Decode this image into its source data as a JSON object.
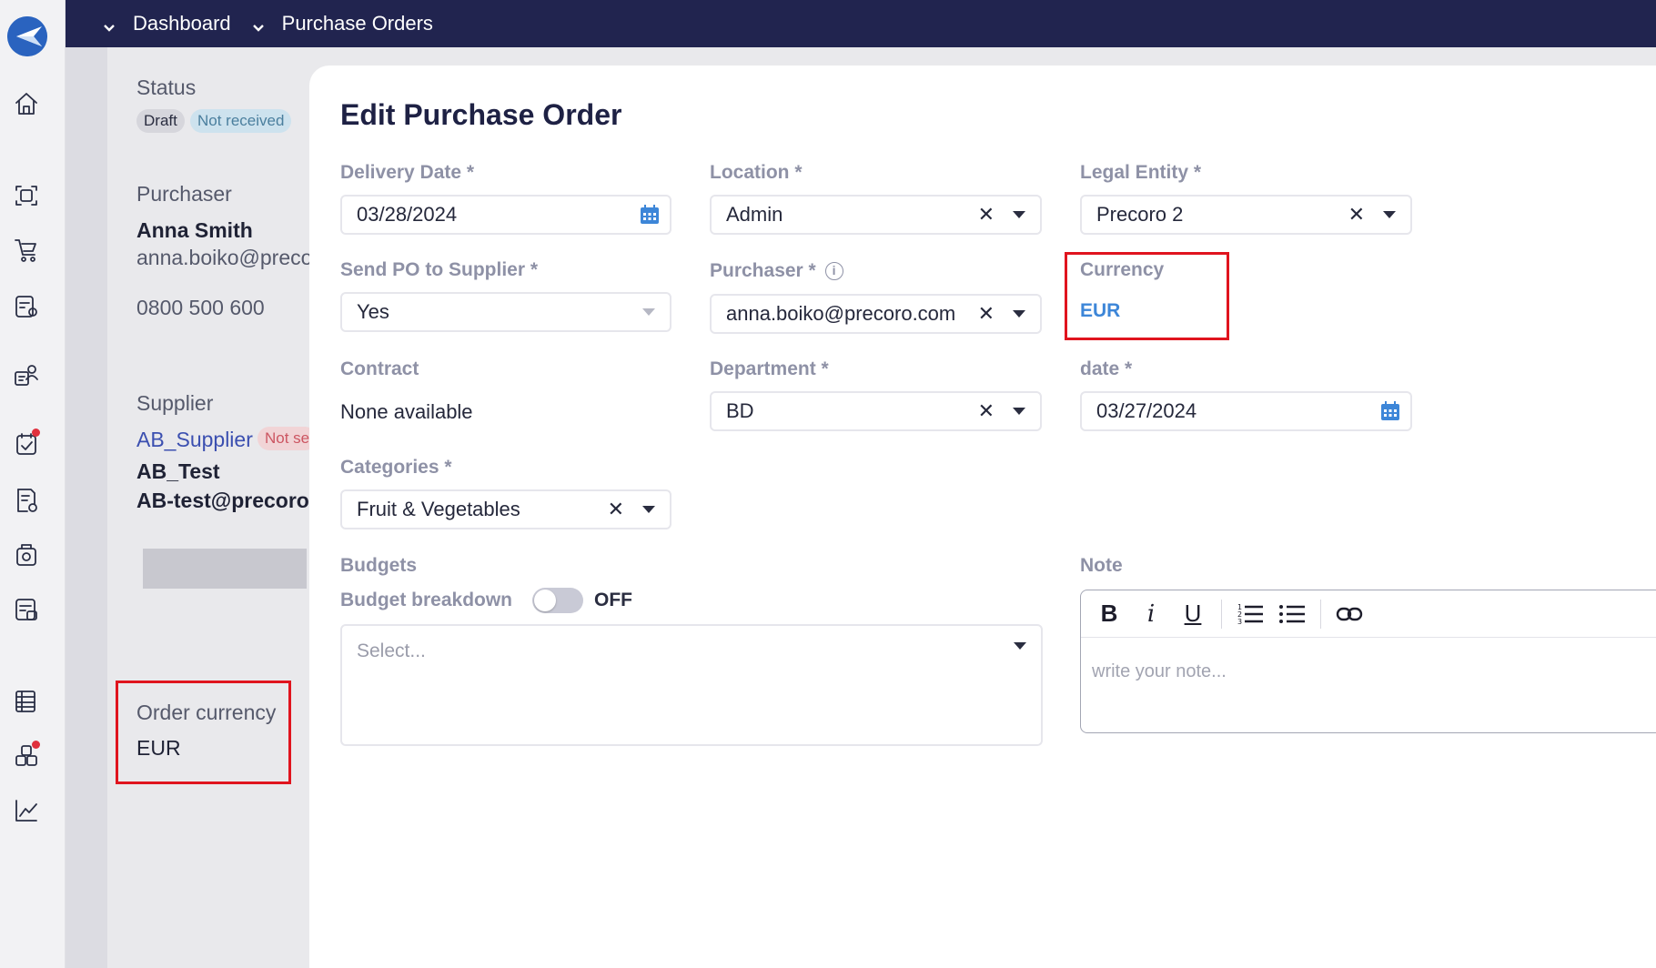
{
  "topbar": {
    "crumbs": [
      "Dashboard",
      "Purchase Orders"
    ]
  },
  "background": {
    "status_label": "Status",
    "badges": [
      "Draft",
      "Not received"
    ],
    "purchaser_label": "Purchaser",
    "purchaser_name": "Anna Smith",
    "purchaser_email": "anna.boiko@preco",
    "purchaser_phone": "0800 500 600",
    "supplier_label": "Supplier",
    "supplier_name": "AB_Supplier",
    "supplier_badge": "Not se",
    "supplier_contact": "AB_Test",
    "supplier_email": "AB-test@precoro.",
    "order_currency_label": "Order currency",
    "order_currency_value": "EUR"
  },
  "modal": {
    "title": "Edit Purchase Order",
    "delivery_date": {
      "label": "Delivery Date *",
      "value": "03/28/2024"
    },
    "location": {
      "label": "Location *",
      "value": "Admin"
    },
    "legal_entity": {
      "label": "Legal Entity *",
      "value": "Precoro 2"
    },
    "send_po": {
      "label": "Send PO to Supplier *",
      "value": "Yes"
    },
    "purchaser": {
      "label": "Purchaser *",
      "value": "anna.boiko@precoro.com"
    },
    "currency": {
      "label": "Currency",
      "value": "EUR"
    },
    "contract": {
      "label": "Contract",
      "value": "None available"
    },
    "department": {
      "label": "Department *",
      "value": "BD"
    },
    "date": {
      "label": "date *",
      "value": "03/27/2024"
    },
    "categories": {
      "label": "Categories *",
      "value": "Fruit & Vegetables"
    },
    "budgets": {
      "label": "Budgets",
      "breakdown_label": "Budget breakdown",
      "toggle_state": "OFF",
      "placeholder": "Select..."
    },
    "note": {
      "label": "Note",
      "placeholder": "write your note..."
    }
  },
  "colors": {
    "topbar": "#21244f",
    "accent": "#3d86d8",
    "highlight": "#e0141e"
  }
}
